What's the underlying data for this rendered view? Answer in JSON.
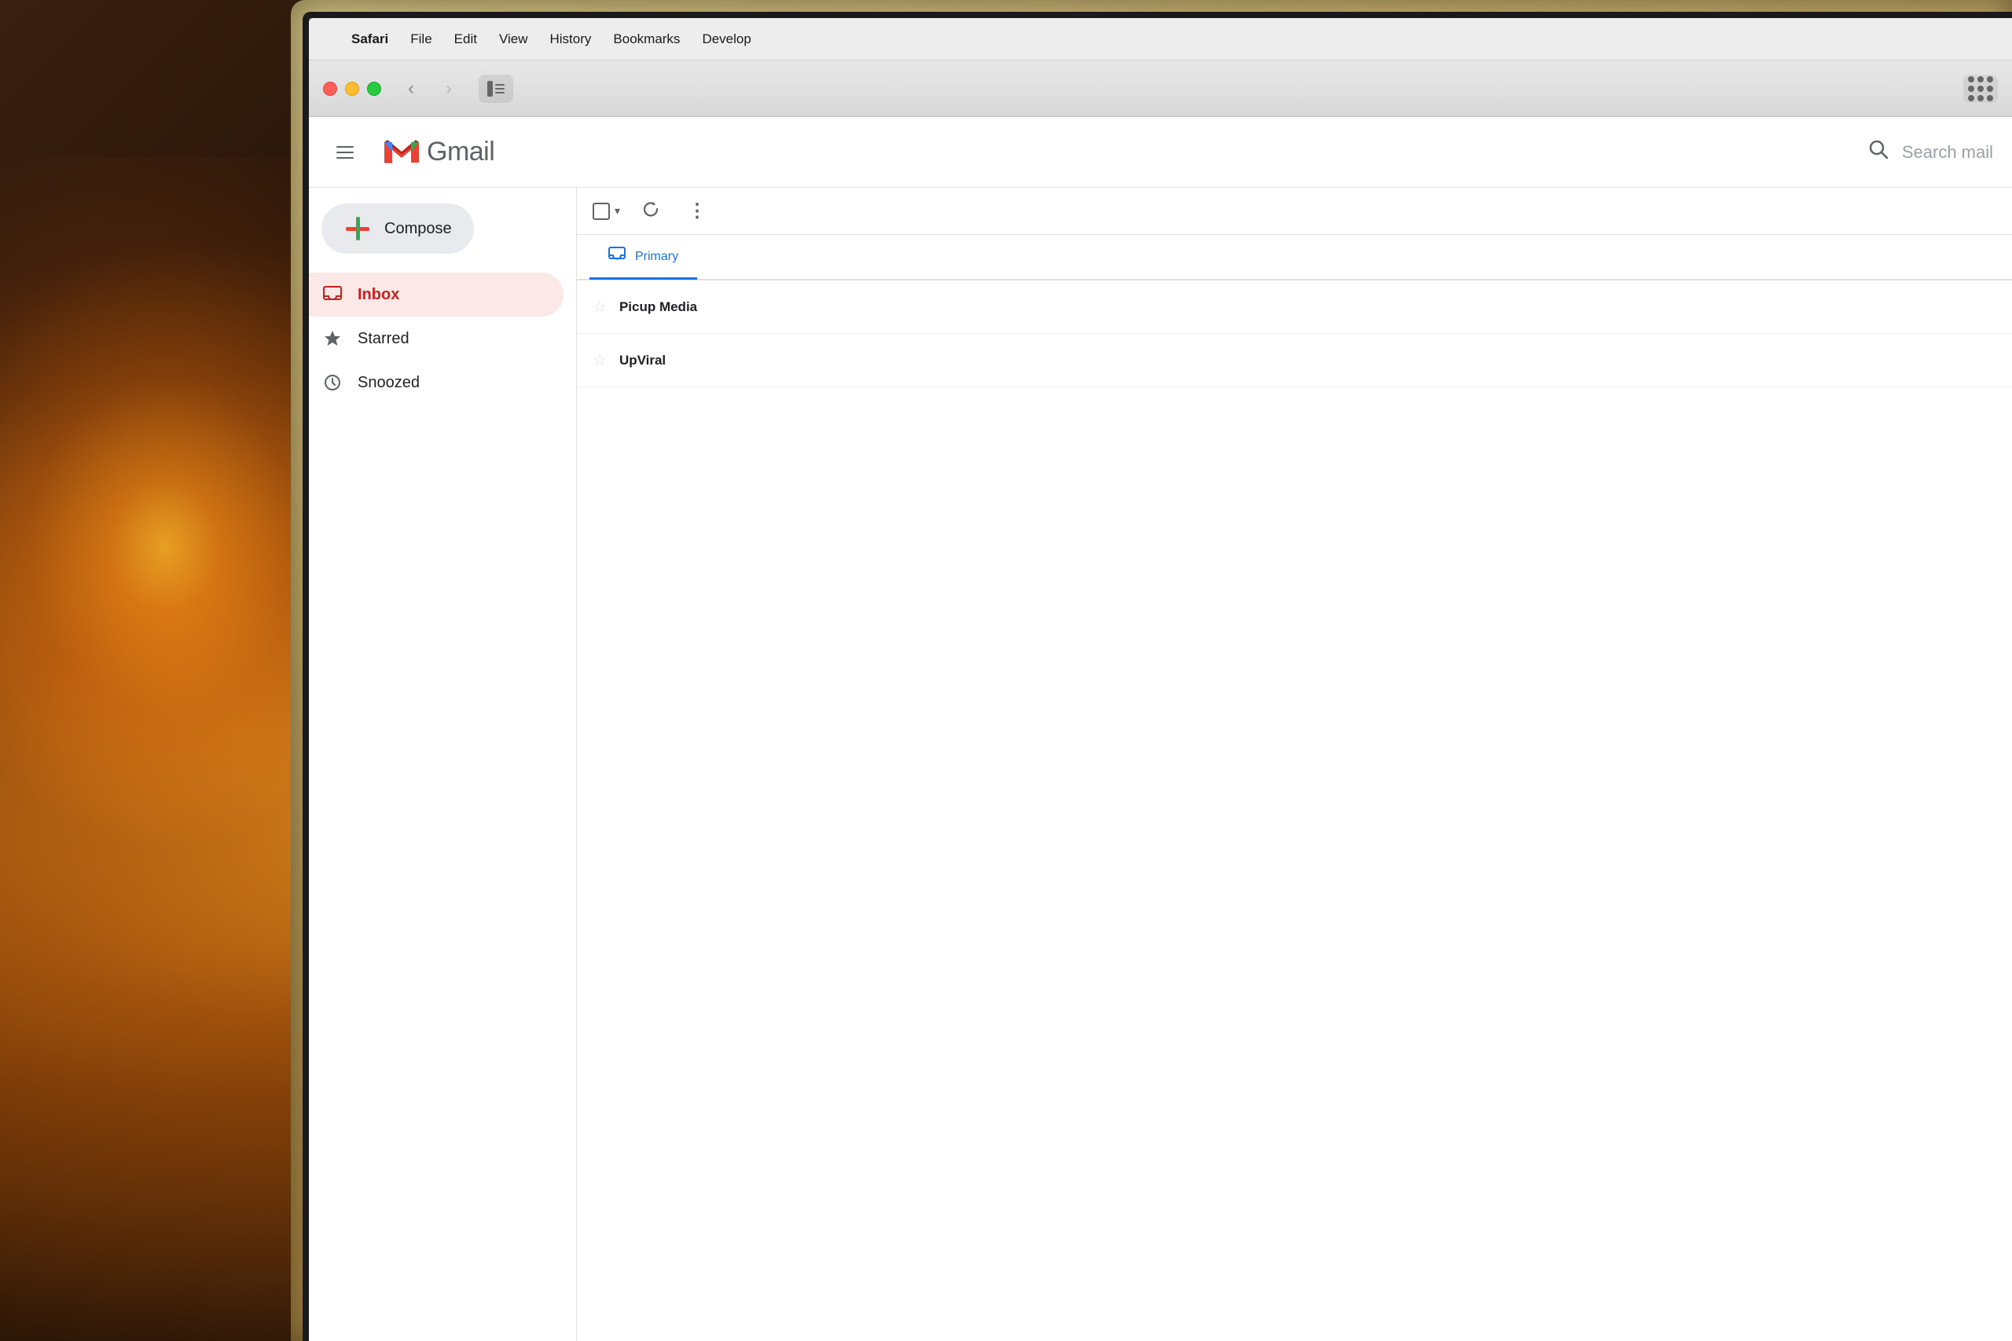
{
  "background": {
    "desc": "Warm bokeh background with glowing lamp"
  },
  "laptop": {
    "frame_color": "#b8a060"
  },
  "macos_menubar": {
    "apple_label": "",
    "items": [
      {
        "label": "Safari",
        "bold": true
      },
      {
        "label": "File"
      },
      {
        "label": "Edit"
      },
      {
        "label": "View"
      },
      {
        "label": "History"
      },
      {
        "label": "Bookmarks"
      },
      {
        "label": "Develop"
      }
    ]
  },
  "safari_toolbar": {
    "back_arrow": "‹",
    "forward_arrow": "›"
  },
  "gmail": {
    "header": {
      "menu_icon": "≡",
      "logo_letter": "M",
      "logo_text": "Gmail",
      "search_placeholder": "Search mail"
    },
    "compose": {
      "label": "Compose"
    },
    "nav_items": [
      {
        "label": "Inbox",
        "active": true,
        "icon": "inbox"
      },
      {
        "label": "Starred",
        "active": false,
        "icon": "star"
      },
      {
        "label": "Snoozed",
        "active": false,
        "icon": "clock"
      }
    ],
    "email_toolbar": {
      "more_label": "⋮",
      "refresh_label": "↻"
    },
    "tabs": [
      {
        "label": "Primary",
        "active": true,
        "icon": "inbox"
      }
    ],
    "emails": [
      {
        "sender": "Picup Media",
        "subject": "",
        "starred": false
      },
      {
        "sender": "UpViral",
        "subject": "",
        "starred": false
      }
    ]
  },
  "colors": {
    "gmail_red": "#ea4335",
    "gmail_blue": "#4285f4",
    "gmail_green": "#34a853",
    "gmail_yellow": "#fbbc05",
    "primary_tab_blue": "#1a73e8",
    "inbox_active_bg": "#fce8e6",
    "inbox_active_text": "#c5221f"
  }
}
